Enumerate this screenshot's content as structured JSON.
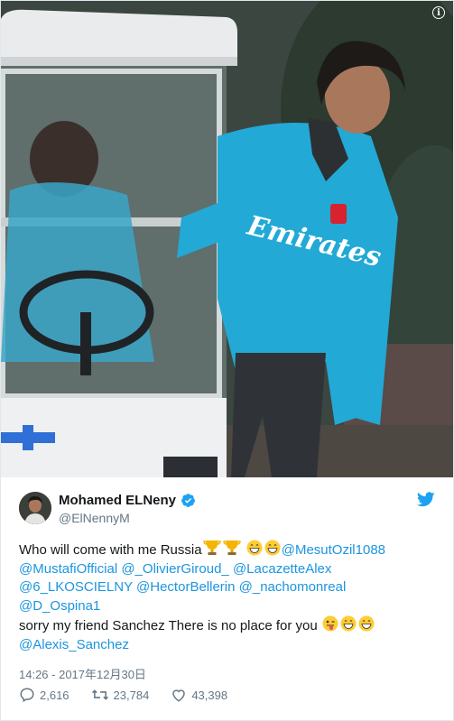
{
  "media": {
    "info_label": "i"
  },
  "author": {
    "display_name": "Mohamed ELNeny",
    "handle": "@ElNennyM",
    "verified": true
  },
  "tweet": {
    "line1": {
      "text": "Who will come with me Russia",
      "mention": "@MesutOzil1088"
    },
    "line2": {
      "m1": "@MustafiOfficial",
      "m2": "@_OlivierGiroud_",
      "m3": "@LacazetteAlex"
    },
    "line3": {
      "m1": "@6_LKOSCIELNY",
      "m2": "@HectorBellerin",
      "m3": "@_nachomonreal"
    },
    "line4": {
      "m1": "@D_Ospina1"
    },
    "line5": {
      "text": "sorry my friend Sanchez There is no place for you"
    },
    "line6": {
      "m1": "@Alexis_Sanchez"
    }
  },
  "timestamp": "14:26 - 2017年12月30日",
  "stats": {
    "replies": "2,616",
    "retweets": "23,784",
    "likes": "43,398"
  },
  "colors": {
    "link": "#1b95e0",
    "secondary_text": "#657786",
    "primary_text": "#14171a",
    "brand_blue": "#1da1f2"
  }
}
